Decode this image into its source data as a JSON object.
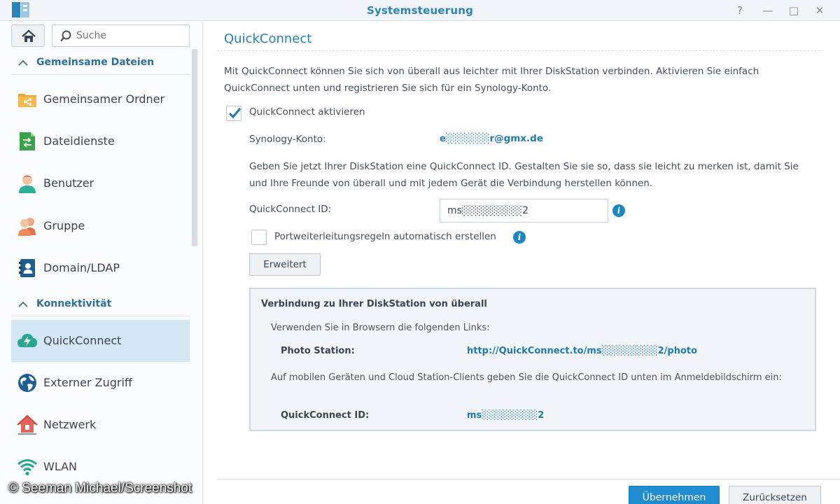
{
  "window": {
    "title": "Systemsteuerung",
    "controls": {
      "help": "?",
      "minimize": "—",
      "maximize": "□",
      "close": "✕"
    }
  },
  "sidebar": {
    "search_placeholder": "Suche",
    "sections": [
      {
        "label": "Gemeinsame Dateien",
        "items": [
          {
            "label": "Gemeinsamer Ordner",
            "icon": "shared-folder-icon"
          },
          {
            "label": "Dateidienste",
            "icon": "file-services-icon"
          },
          {
            "label": "Benutzer",
            "icon": "user-icon"
          },
          {
            "label": "Gruppe",
            "icon": "group-icon"
          },
          {
            "label": "Domain/LDAP",
            "icon": "domain-ldap-icon"
          }
        ]
      },
      {
        "label": "Konnektivität",
        "items": [
          {
            "label": "QuickConnect",
            "icon": "quickconnect-icon",
            "active": true
          },
          {
            "label": "Externer Zugriff",
            "icon": "globe-icon"
          },
          {
            "label": "Netzwerk",
            "icon": "network-house-icon"
          },
          {
            "label": "WLAN",
            "icon": "wifi-icon"
          }
        ]
      }
    ]
  },
  "main": {
    "title": "QuickConnect",
    "description": "Mit QuickConnect können Sie sich von überall aus leichter mit Ihrer DiskStation verbinden. Aktivieren Sie einfach QuickConnect unten und registrieren Sie sich für ein Synology-Konto.",
    "enable_label": "QuickConnect aktivieren",
    "enable_checked": true,
    "account_label": "Synology-Konto:",
    "account_value": "e░░░░░░r@gmx.de",
    "id_hint": "Geben Sie jetzt Ihrer DiskStation eine QuickConnect ID. Gestalten Sie sie so, dass sie leicht zu merken ist, damit Sie und Ihre Freunde von überall und mit jedem Gerät die Verbindung herstellen können.",
    "id_label": "QuickConnect ID:",
    "id_value": "ms░░░░░░░░2",
    "port_label": "Portweiterleitungsregeln automatisch erstellen",
    "port_checked": false,
    "advanced_button": "Erweitert",
    "infobox": {
      "heading": "Verbindung zu Ihrer DiskStation von überall",
      "browser_text": "Verwenden Sie in Browsern die folgenden Links:",
      "photo_label": "Photo Station:",
      "photo_link": "http://QuickConnect.to/ms░░░░░░░░2/photo",
      "mobile_text": "Auf mobilen Geräten und Cloud Station-Clients geben Sie die QuickConnect ID unten im Anmeldebildschirm ein:",
      "id_label": "QuickConnect ID:",
      "id_value": "ms░░░░░░░░2"
    },
    "apply_button": "Übernehmen",
    "reset_button": "Zurücksetzen"
  },
  "watermark": "© Seeman Michael/Screenshot",
  "colors": {
    "accent": "#1f8cd1",
    "title_blue": "#2a83b9",
    "active_nav": "#d4e7f5",
    "section_head": "#2c6f99"
  }
}
